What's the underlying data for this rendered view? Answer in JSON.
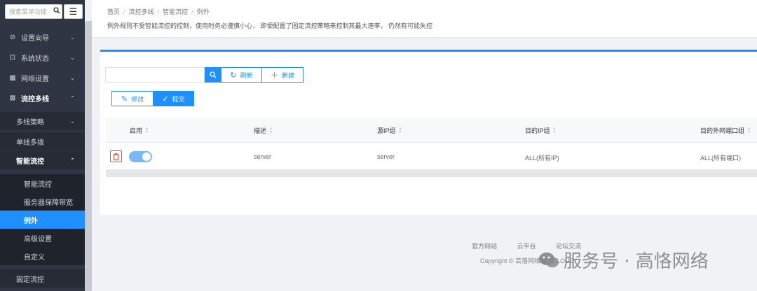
{
  "sidebar": {
    "search_placeholder": "搜索菜单功能",
    "items": [
      {
        "label": "设置向导",
        "icon": "compass-icon"
      },
      {
        "label": "系统状态",
        "icon": "chart-icon"
      },
      {
        "label": "网络设置",
        "icon": "network-icon"
      },
      {
        "label": "流控多线",
        "icon": "flow-icon"
      }
    ],
    "sub_items": [
      {
        "label": "多线策略"
      },
      {
        "label": "单线多拨"
      },
      {
        "label": "智能流控"
      }
    ],
    "subsub_items": [
      {
        "label": "智能流控"
      },
      {
        "label": "服务器保障带宽"
      },
      {
        "label": "例外"
      },
      {
        "label": "高级设置"
      },
      {
        "label": "自定义"
      }
    ],
    "last_item": "固定流控"
  },
  "breadcrumb": [
    "首页",
    "流控多线",
    "智能流控",
    "例外"
  ],
  "notice": "例外规则不受智能流控的控制，使用时务必谨慎小心， 即便配置了固定流控策略来控制其最大速率， 仍然有可能失控",
  "toolbar": {
    "refresh_label": "刷新",
    "new_label": "新建",
    "edit_label": "修改",
    "submit_label": "提交"
  },
  "table": {
    "columns": [
      "启用",
      "描述",
      "源IP组",
      "目的IP组",
      "目的外网端口组"
    ],
    "rows": [
      {
        "enabled": true,
        "description": "server",
        "src_ip": "server",
        "dst_ip": "ALL(所有IP)",
        "dst_port": "ALL(所有端口)"
      }
    ]
  },
  "footer": {
    "links": [
      "官方网站",
      "云平台",
      "论坛交流"
    ],
    "copyright": "Copyright © 高恪网络 GOCLOUD"
  },
  "watermark": "服务号 · 高恪网络",
  "colors": {
    "accent": "#1e90ff",
    "sidebar": "#2f3542",
    "danger": "#e74c3c"
  }
}
